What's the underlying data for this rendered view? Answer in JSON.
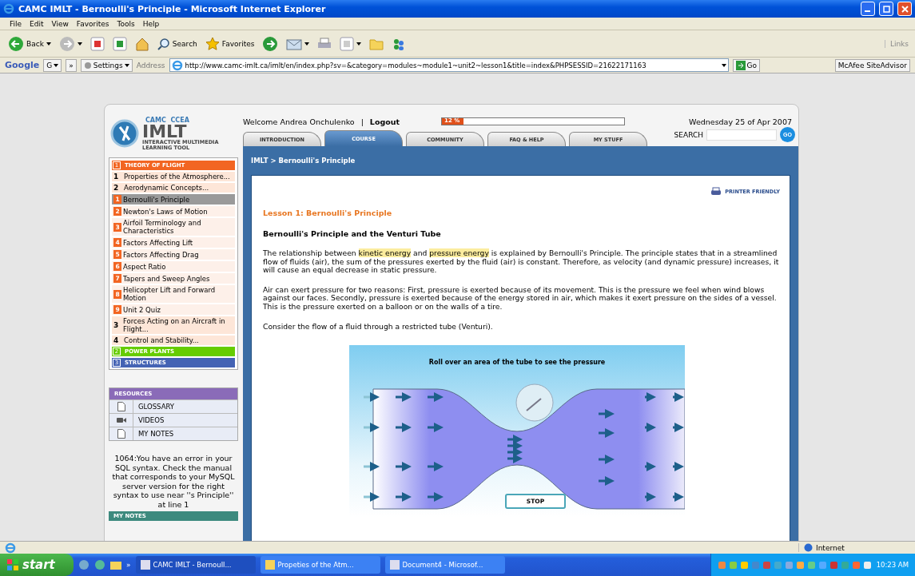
{
  "window": {
    "title": "CAMC IMLT - Bernoulli's Principle - Microsoft Internet Explorer"
  },
  "menu": [
    "File",
    "Edit",
    "View",
    "Favorites",
    "Tools",
    "Help"
  ],
  "toolbar": {
    "back": "Back",
    "search": "Search",
    "favorites": "Favorites",
    "links": "Links"
  },
  "google_bar": {
    "logo": "Google",
    "google_button": "G",
    "more": "»",
    "settings": "Settings",
    "address_label": "Address",
    "url": "http://www.camc-imlt.ca/imlt/en/index.php?sv=&category=modules~module1~unit2~lesson1&title=index&PHPSESSID=21622171163",
    "go": "Go",
    "advisor": "McAfee SiteAdvisor"
  },
  "site": {
    "logo": {
      "org": "CAMC  CCEA",
      "name": "IMLT",
      "tagline": "INTERACTIVE MULTIMEDIA LEARNING TOOL"
    },
    "welcome": "Welcome Andrea Onchulenko",
    "separator": "|",
    "logout": "Logout",
    "progress": {
      "label": "12 %",
      "level": 0.12
    },
    "date": "Wednesday 25 of Apr 2007",
    "search": {
      "label": "SEARCH",
      "button": "GO"
    },
    "tabs": [
      {
        "label": "INTRODUCTION",
        "selected": false
      },
      {
        "label": "COURSE",
        "selected": true
      },
      {
        "label": "COMMUNITY",
        "selected": false
      },
      {
        "label": "FAQ & HELP",
        "selected": false
      },
      {
        "label": "MY STUFF",
        "selected": false
      }
    ],
    "breadcrumb": "IMLT > Bernoulli's Principle"
  },
  "sidebar": {
    "sections": [
      {
        "number": "1",
        "title": "THEORY OF FLIGHT",
        "color": "#f26522",
        "children": [
          {
            "number": "1",
            "title": "Properties of the Atmosphere..."
          },
          {
            "number": "2",
            "title": "Aerodynamic Concepts...",
            "children": [
              {
                "number": "1",
                "title": "Bernoulli's Principle",
                "selected": true
              },
              {
                "number": "2",
                "title": "Newton's Laws of Motion",
                "selected": false
              },
              {
                "number": "3",
                "title": "Airfoil Terminology and Characteristics",
                "selected": false
              },
              {
                "number": "4",
                "title": "Factors Affecting Lift",
                "selected": false
              },
              {
                "number": "5",
                "title": "Factors Affecting Drag",
                "selected": false
              },
              {
                "number": "6",
                "title": "Aspect Ratio",
                "selected": false
              },
              {
                "number": "7",
                "title": "Tapers and Sweep Angles",
                "selected": false
              },
              {
                "number": "8",
                "title": "Helicopter Lift and Forward Motion",
                "selected": false
              },
              {
                "number": "9",
                "title": "Unit 2 Quiz",
                "selected": false
              }
            ]
          },
          {
            "number": "3",
            "title": "Forces Acting on an Aircraft in Flight..."
          },
          {
            "number": "4",
            "title": "Control and Stability..."
          }
        ]
      },
      {
        "number": "2",
        "title": "POWER PLANTS",
        "color": "#66cc00"
      },
      {
        "number": "3",
        "title": "STRUCTURES",
        "color": "#4463b4"
      }
    ],
    "resources": {
      "title": "RESOURCES",
      "items": [
        {
          "kind": "document",
          "label": "GLOSSARY"
        },
        {
          "kind": "video",
          "label": "VIDEOS"
        },
        {
          "kind": "document",
          "label": "MY NOTES"
        }
      ]
    },
    "error": "1064:You have an error in your SQL syntax. Check the manual that corresponds to your MySQL server version for the right syntax to use near ''s Principle'' at line 1",
    "notes_header": "MY NOTES"
  },
  "content": {
    "printer": "PRINTER FRIENDLY",
    "lesson": "Lesson 1: Bernoulli's Principle",
    "heading": "Bernoulli's Principle and the Venturi Tube",
    "paragraphs": [
      "The relationship between **kinetic energy** and **pressure energy** is explained by Bernoulli's Principle. The principle states that in a streamlined flow of fluids (air), the sum of the pressures exerted by the fluid (air) is constant. Therefore, as velocity (and dynamic pressure) increases, it will cause an equal decrease in static pressure.",
      "Air can exert pressure for two reasons: First, pressure is exerted because of its movement. This is the pressure we feel when wind blows against our faces. Secondly, pressure is exerted because of the energy stored in air, which makes it exert pressure on the sides of a vessel. This is the pressure exerted on a balloon or on the walls of a tire.",
      "Consider the flow of a fluid through a restricted tube (Venturi)."
    ],
    "diagram": {
      "title": "Roll over an area of the tube to see the pressure",
      "button": "STOP"
    }
  },
  "status_bar": {
    "zone": "Internet"
  },
  "taskbar": {
    "start": "start",
    "more": "»",
    "tasks": [
      "CAMC IMLT - Bernoull...",
      "Propeties of the Atm...",
      "Document4 - Microsof..."
    ],
    "time": "10:23 AM"
  }
}
